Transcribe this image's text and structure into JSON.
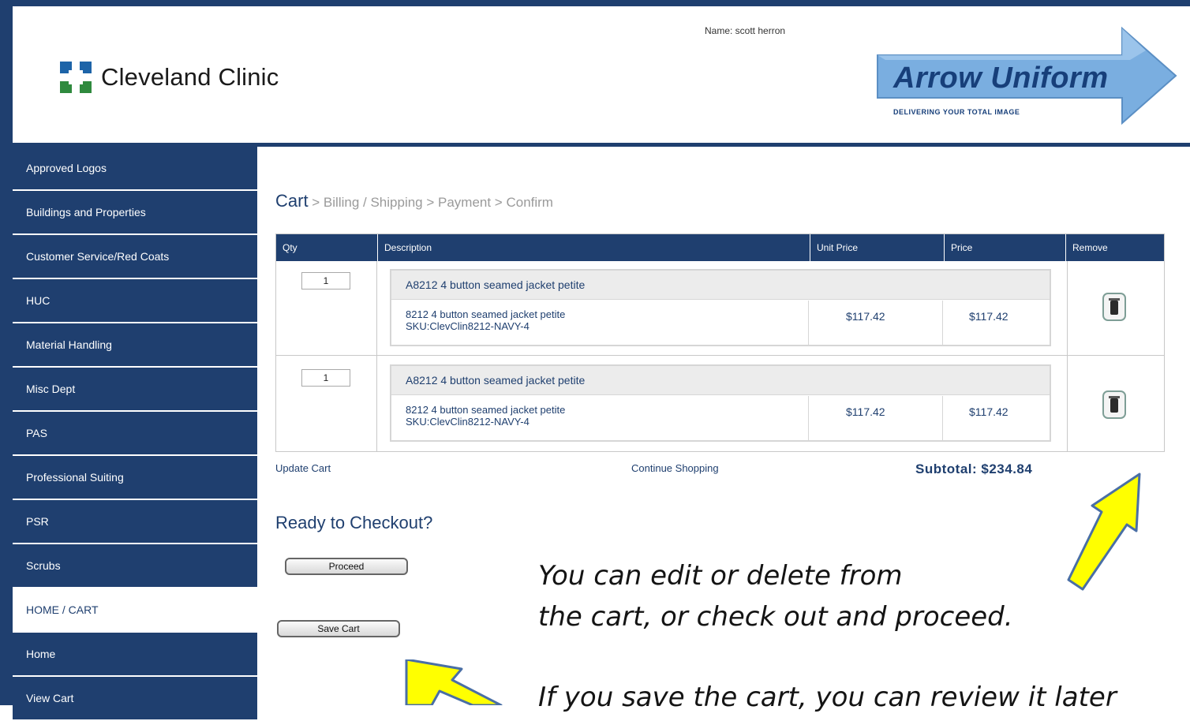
{
  "header": {
    "logo_text": "Cleveland Clinic",
    "user_name": "Name: scott herron",
    "vendor_logo_title": "Arrow Uniform",
    "vendor_logo_tagline": "DELIVERING YOUR TOTAL IMAGE"
  },
  "sidebar": {
    "items": [
      {
        "label": "Approved Logos"
      },
      {
        "label": "Buildings and Properties"
      },
      {
        "label": "Customer Service/Red Coats"
      },
      {
        "label": "HUC"
      },
      {
        "label": "Material Handling"
      },
      {
        "label": "Misc Dept"
      },
      {
        "label": "PAS"
      },
      {
        "label": "Professional Suiting"
      },
      {
        "label": "PSR"
      },
      {
        "label": "Scrubs"
      },
      {
        "label": "HOME / CART"
      },
      {
        "label": "Home"
      },
      {
        "label": "View Cart"
      }
    ]
  },
  "breadcrumb": {
    "current": "Cart",
    "rest": " > Billing / Shipping > Payment > Confirm"
  },
  "table": {
    "headers": {
      "qty": "Qty",
      "description": "Description",
      "unit_price": "Unit Price",
      "price": "Price",
      "remove": "Remove"
    },
    "rows": [
      {
        "qty": "1",
        "title": "A8212 4 button seamed jacket petite",
        "desc_line1": "8212 4 button seamed jacket petite",
        "desc_line2": "SKU:ClevClin8212-NAVY-4",
        "unit_price": "$117.42",
        "price": "$117.42"
      },
      {
        "qty": "1",
        "title": "A8212 4 button seamed jacket petite",
        "desc_line1": "8212 4 button seamed jacket petite",
        "desc_line2": "SKU:ClevClin8212-NAVY-4",
        "unit_price": "$117.42",
        "price": "$117.42"
      }
    ]
  },
  "actions": {
    "update_cart": "Update Cart",
    "continue_shopping": "Continue Shopping",
    "subtotal": "Subtotal: $234.84",
    "ready_heading": "Ready to Checkout?",
    "proceed": "Proceed",
    "save_cart": "Save Cart"
  },
  "annotations": {
    "note_line1": "You can edit or delete from",
    "note_line2": "the cart, or check out and proceed.",
    "note_line3": "If you save the cart, you can review it later"
  },
  "colors": {
    "navy": "#1f3f6f",
    "highlight_arrow": "#ffff00",
    "arrow_outline": "#4a6fa5"
  }
}
